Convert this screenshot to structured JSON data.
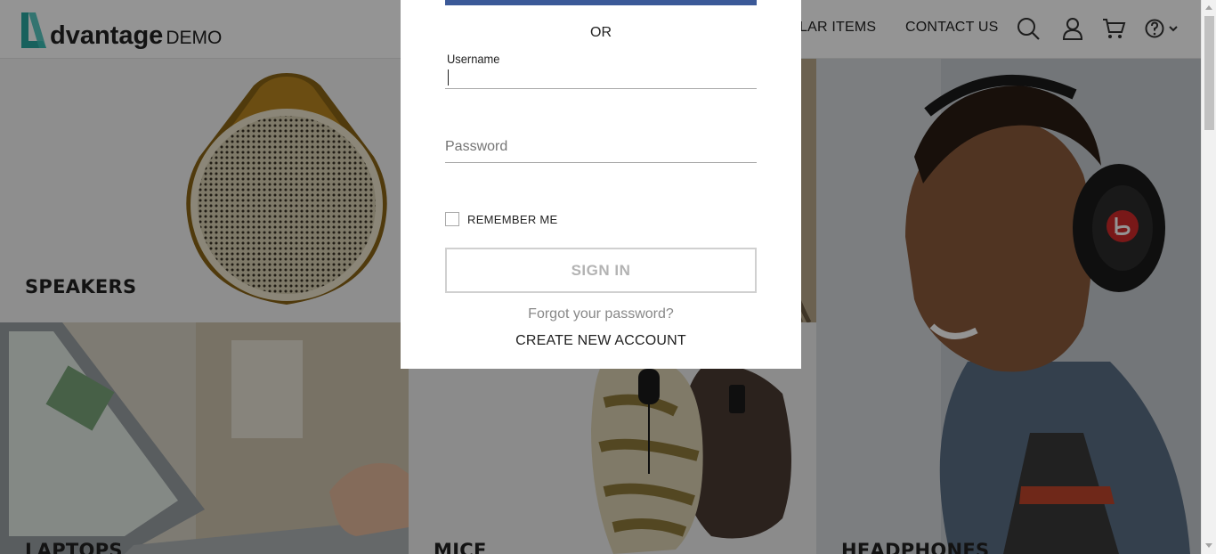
{
  "header": {
    "logo_brand": "dvantage",
    "logo_demo": "DEMO",
    "nav_popular": "LAR ITEMS",
    "nav_contact": "CONTACT US",
    "icons": [
      "search-icon",
      "user-icon",
      "cart-icon",
      "help-icon",
      "chevron-down-icon"
    ]
  },
  "categories": {
    "speakers": "SPEAKERS",
    "laptops": "LAPTOPS",
    "mice": "MICE",
    "headphones": "HEADPHONES"
  },
  "login": {
    "or_text": "OR",
    "username_label": "Username",
    "username_value": "",
    "password_placeholder": "Password",
    "password_value": "",
    "remember_label": "REMEMBER ME",
    "remember_checked": false,
    "signin_label": "SIGN IN",
    "forgot_label": "Forgot your password?",
    "create_label": "CREATE NEW ACCOUNT"
  },
  "colors": {
    "facebook_bar": "#3b5998",
    "logo_accent": "#2aa7a0",
    "overlay": "rgba(0,0,0,0.42)"
  }
}
